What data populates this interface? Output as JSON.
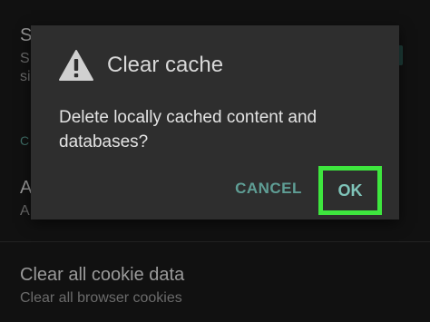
{
  "background": {
    "item1_title_fragment": "S",
    "item1_sub_fragment_1": "S",
    "item1_sub_fragment_2": "si",
    "section_fragment": "C",
    "item2_title_fragment": "A",
    "item2_sub_fragment": "A",
    "cookie_item": {
      "title": "Clear all cookie data",
      "subtitle": "Clear all browser cookies"
    }
  },
  "dialog": {
    "icon": "warning-icon",
    "title": "Clear cache",
    "message": "Delete locally cached content and databases?",
    "cancel_label": "CANCEL",
    "ok_label": "OK",
    "highlight_color": "#3ee63e",
    "accent_color": "#5f9e95"
  }
}
